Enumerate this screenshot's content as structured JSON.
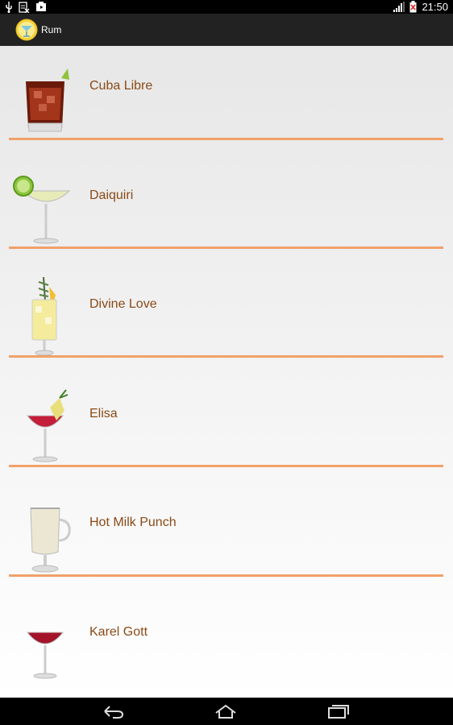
{
  "status_bar": {
    "time": "21:50",
    "icons": [
      "usb-icon",
      "sim-off-icon",
      "media-icon",
      "signal-icon",
      "battery-alert-icon"
    ]
  },
  "action_bar": {
    "title": "Rum",
    "icon": "lemon-cocktail-icon"
  },
  "cocktails": [
    {
      "name": "Cuba Libre",
      "icon": "rocks-glass-cola-icon"
    },
    {
      "name": "Daiquiri",
      "icon": "coupe-glass-lime-icon"
    },
    {
      "name": "Divine Love",
      "icon": "highball-glass-icon"
    },
    {
      "name": "Elisa",
      "icon": "red-coupe-glass-icon"
    },
    {
      "name": "Hot Milk Punch",
      "icon": "irish-coffee-glass-icon"
    },
    {
      "name": "Karel Gott",
      "icon": "red-coupe-glass-icon"
    }
  ],
  "colors": {
    "divider": "#f0a16a",
    "label_text": "#8a4a16",
    "action_bar": "#222222"
  },
  "nav_bar": {
    "icons": [
      "back-icon",
      "home-icon",
      "recent-apps-icon"
    ]
  }
}
